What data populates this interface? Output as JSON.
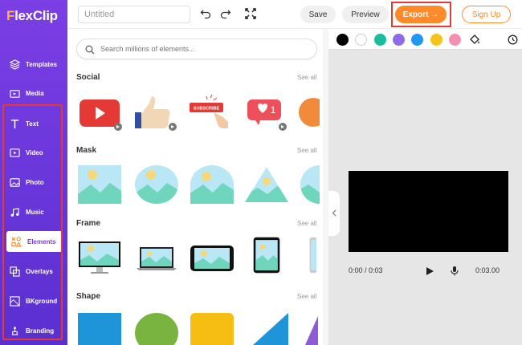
{
  "app": {
    "logo_f": "F",
    "logo_rest": "lexClip"
  },
  "sidebar": {
    "items": [
      {
        "label": "Templates",
        "icon": "layers-icon"
      },
      {
        "label": "Media",
        "icon": "media-folder-icon"
      },
      {
        "label": "Text",
        "icon": "text-icon"
      },
      {
        "label": "Video",
        "icon": "video-icon"
      },
      {
        "label": "Photo",
        "icon": "photo-icon"
      },
      {
        "label": "Music",
        "icon": "music-icon"
      },
      {
        "label": "Elements",
        "icon": "elements-icon",
        "active": true
      },
      {
        "label": "Overlays",
        "icon": "overlays-icon"
      },
      {
        "label": "BKground",
        "icon": "background-icon"
      },
      {
        "label": "Branding",
        "icon": "branding-icon"
      }
    ]
  },
  "topbar": {
    "title_placeholder": "Untitled",
    "save_label": "Save",
    "preview_label": "Preview",
    "export_label": "Export →",
    "signup_label": "Sign Up"
  },
  "panel": {
    "search_placeholder": "Search millions of elements...",
    "see_all": "See all",
    "sections": [
      {
        "title": "Social"
      },
      {
        "title": "Mask"
      },
      {
        "title": "Frame"
      },
      {
        "title": "Shape"
      }
    ],
    "subscribe_text": "SUBSCRIBE",
    "like_count": "1"
  },
  "editor": {
    "colors": [
      "#000000",
      "#ffffff",
      "#1abc9c",
      "#8e6be8",
      "#2196f3",
      "#f6c21c",
      "#f48fb1"
    ],
    "time_current": "0:00 / 0:03",
    "time_total": "0:03.00"
  }
}
